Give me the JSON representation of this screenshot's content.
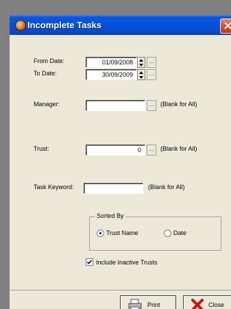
{
  "window": {
    "title": "Incomplete Tasks"
  },
  "icons": {
    "title": "app-icon",
    "close": "close-icon",
    "print": "printer-icon",
    "close_btn": "close-x-icon"
  },
  "form": {
    "from_date": {
      "label": "From Date:",
      "value": "01/09/2008"
    },
    "to_date": {
      "label": "To Date:",
      "value": "30/09/2009"
    },
    "manager": {
      "label": "Manager:",
      "value": "",
      "hint": "(Blank for All)"
    },
    "trust": {
      "label": "Trust:",
      "value": "0",
      "hint": "(Blank for All)"
    },
    "task_keyword": {
      "label": "Task Keyword:",
      "value": "",
      "hint": "(Blank for All)"
    },
    "browse_label": "..."
  },
  "sorted_by": {
    "title": "Sorted By",
    "options": [
      {
        "label": "Trust Name",
        "selected": true
      },
      {
        "label": "Date",
        "selected": false
      }
    ]
  },
  "include_inactive": {
    "label": "Include Inactive Trusts",
    "checked": true
  },
  "buttons": {
    "print": "Print",
    "close": "Close"
  }
}
